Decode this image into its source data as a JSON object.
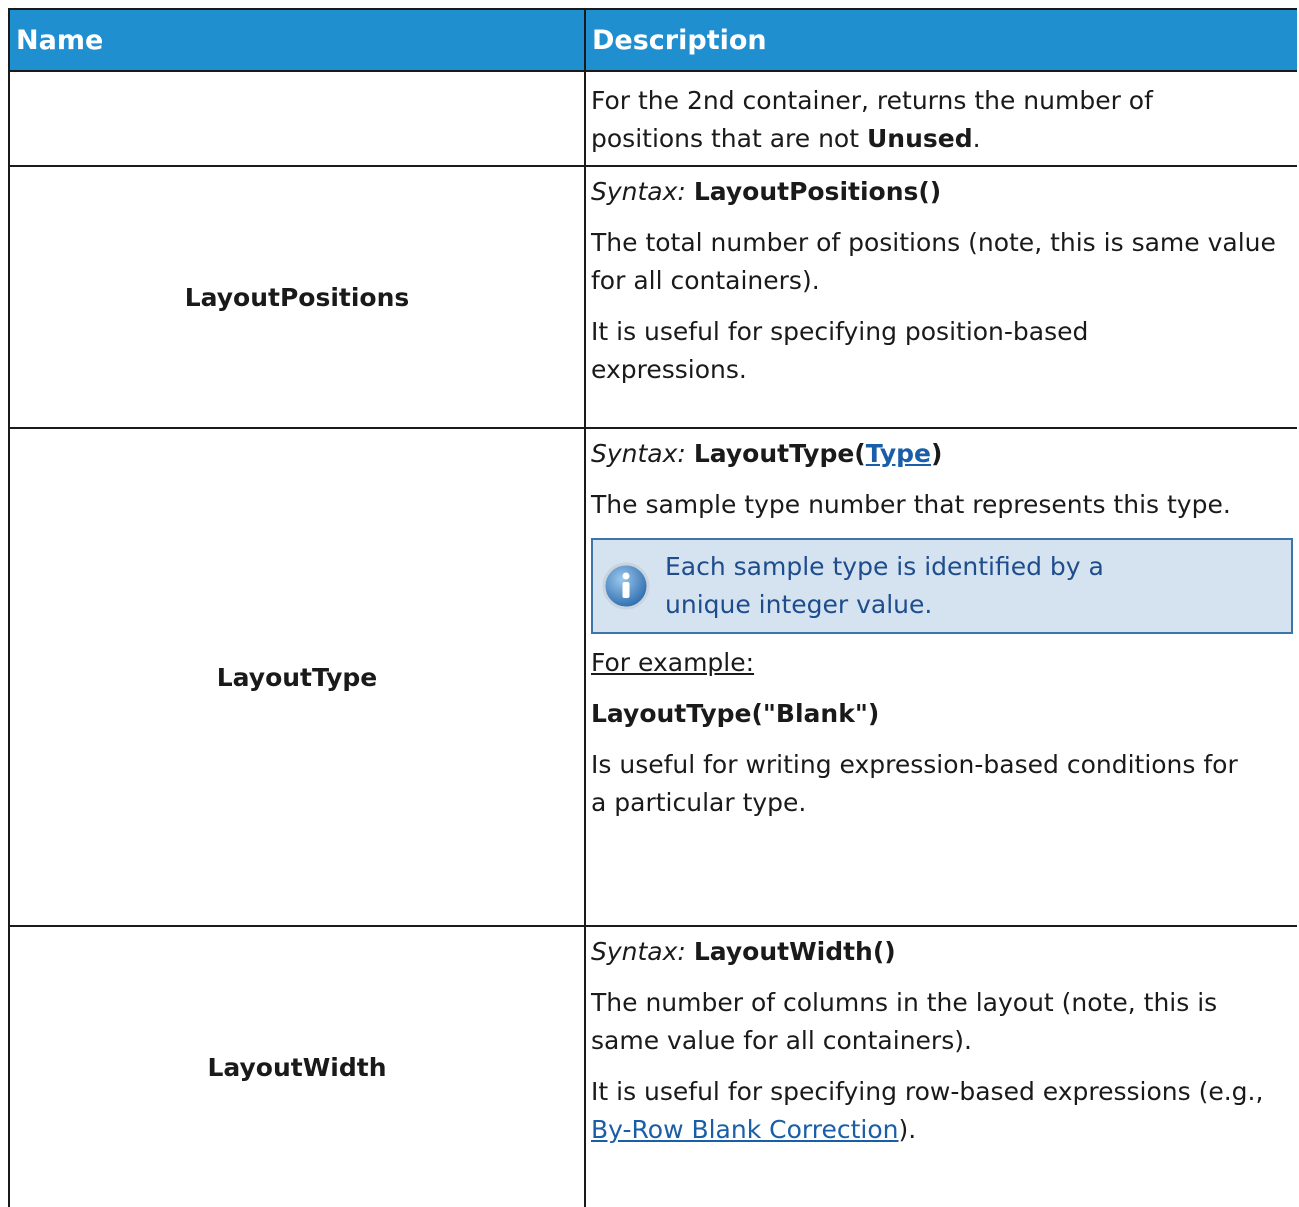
{
  "header": {
    "col_name": "Name",
    "col_desc": "Description"
  },
  "row0": {
    "line1": "For the 2nd container, returns the number of",
    "line2_pre": "positions that are not ",
    "line2_bold": "Unused",
    "line2_post": "."
  },
  "row1": {
    "name": "LayoutPositions",
    "syntax_label": "Syntax:",
    "syntax_code": "LayoutPositions()",
    "desc1": "The total number of positions (note, this is same value for all containers).",
    "desc2": "It is useful for specifying position-based expressions."
  },
  "row2": {
    "name": "LayoutType",
    "syntax_label": "Syntax:",
    "syntax_pre": "LayoutType(",
    "syntax_link": "Type",
    "syntax_post": ")",
    "desc1": "The sample type number that represents this type.",
    "note_icon": "info-icon",
    "note": "Each sample type is identified by a unique integer value.",
    "example_label": "For example:",
    "example_code": "LayoutType(\"Blank\")",
    "desc2": "Is useful for writing expression-based conditions for a particular type."
  },
  "row3": {
    "name": "LayoutWidth",
    "syntax_label": "Syntax:",
    "syntax_code": "LayoutWidth()",
    "desc1": "The number of columns in the layout (note, this is same value for all containers).",
    "desc2_pre": "It is useful for specifying row-based expressions (e.g., ",
    "desc2_link": "By-Row Blank Correction",
    "desc2_post": ")."
  },
  "colors": {
    "header_bg": "#1f8fd0",
    "note_bg": "#d4e3ef",
    "note_border": "#3f74a8",
    "link": "#1a5ea8"
  }
}
